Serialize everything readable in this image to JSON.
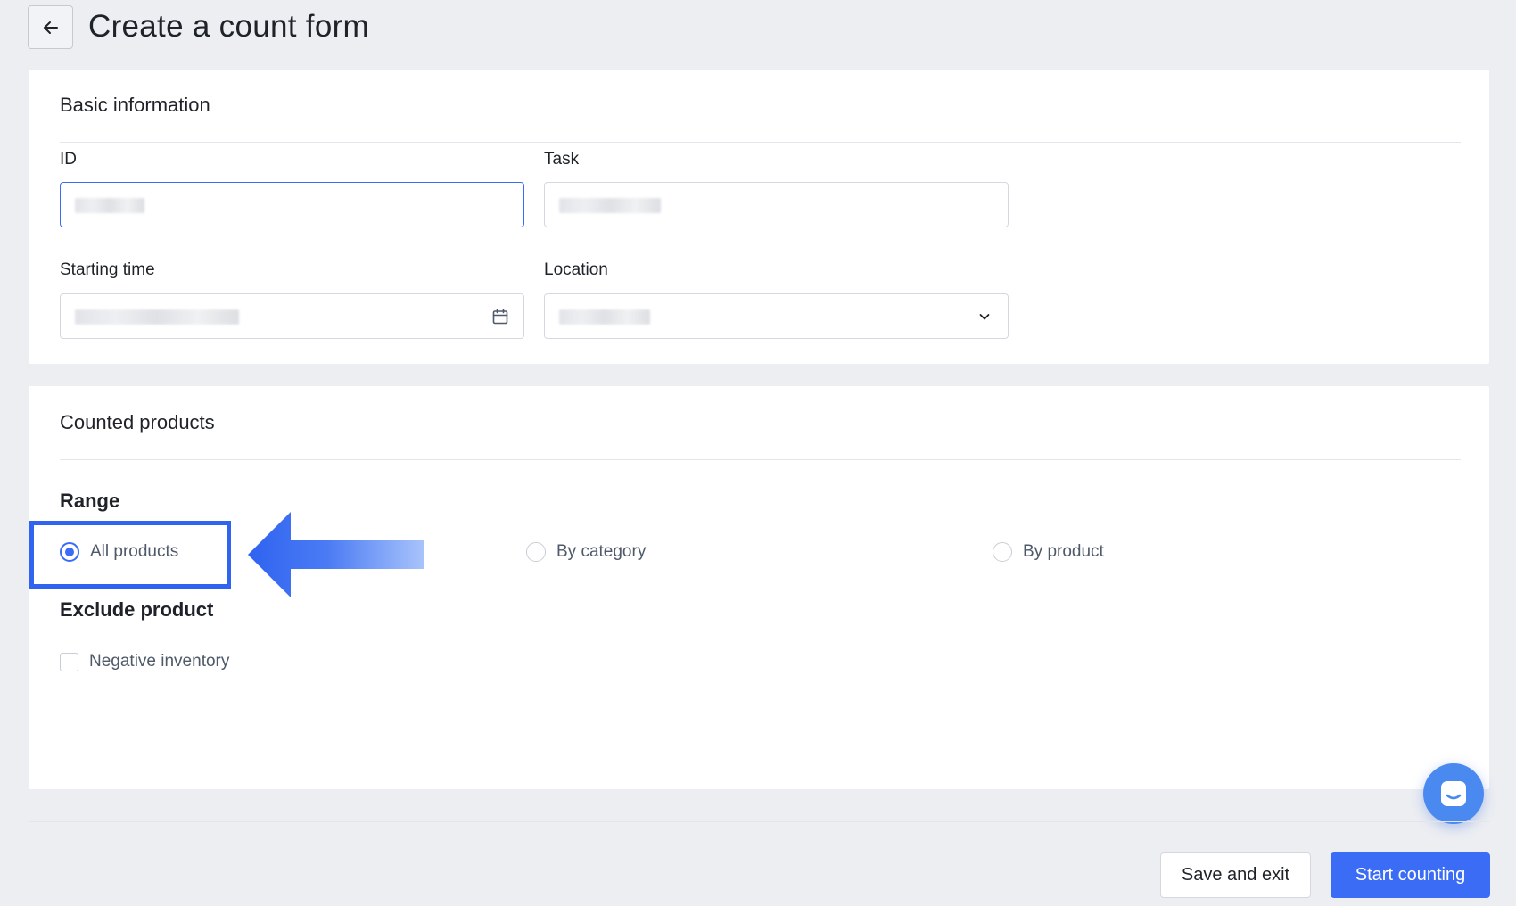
{
  "header": {
    "back_icon": "arrow-left-icon",
    "title": "Create a count form"
  },
  "basic_info": {
    "title": "Basic information",
    "id_label": "ID",
    "task_label": "Task",
    "starting_time_label": "Starting time",
    "location_label": "Location",
    "calendar_icon": "calendar-icon",
    "dropdown_icon": "chevron-down-icon"
  },
  "counted_products": {
    "title": "Counted products",
    "range_label": "Range",
    "range_options": [
      {
        "label": "All products",
        "checked": true
      },
      {
        "label": "By category",
        "checked": false
      },
      {
        "label": "By product",
        "checked": false
      }
    ],
    "exclude_label": "Exclude product",
    "exclude_options": [
      {
        "label": "Negative inventory",
        "checked": false
      }
    ]
  },
  "annotation": {
    "highlight_color": "#2f63f0",
    "arrow_icon": "arrow-left-annotation"
  },
  "chat": {
    "icon": "chat-icon"
  },
  "footer": {
    "save_label": "Save and exit",
    "start_label": "Start counting"
  },
  "colors": {
    "primary": "#3b6cf6",
    "background": "#eceef2"
  }
}
